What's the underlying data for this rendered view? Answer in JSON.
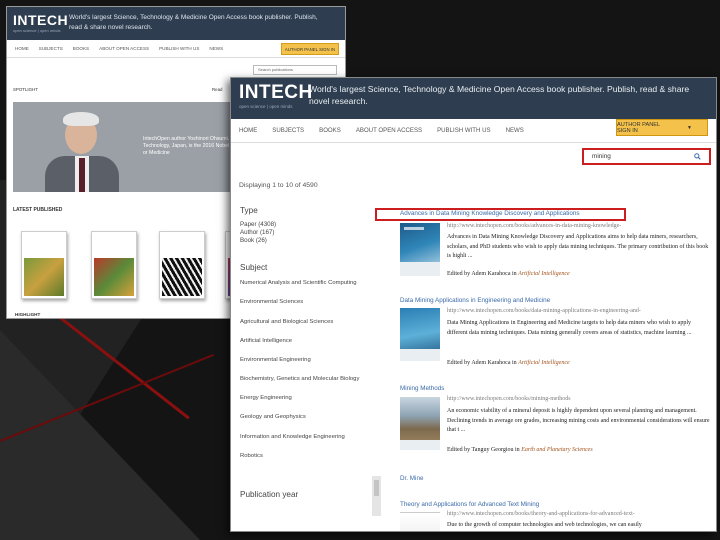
{
  "back_window": {
    "logo": "INTECH",
    "logo_sub": "open science | open minds",
    "tagline": "World's largest Science, Technology & Medicine Open Access book publisher. Publish, read & share novel research.",
    "nav": [
      "HOME",
      "SUBJECTS",
      "BOOKS",
      "ABOUT OPEN ACCESS",
      "PUBLISH WITH US",
      "NEWS"
    ],
    "author_button": "AUTHOR PANEL SIGN IN",
    "search_placeholder": "Search publications",
    "label_left": "SPOTLIGHT",
    "label_right": "Read",
    "banner_text": "IntechOpen author Yoshinori Ohsumi, Tokyo Institute of Technology, Japan, is the 2016 Nobel laureate in Physiology or Medicine",
    "latest": "LATEST PUBLISHED",
    "highlight": "HIGHLIGHT"
  },
  "front_window": {
    "logo": "INTECH",
    "logo_sub": "open science | open minds",
    "tagline": "World's largest Science, Technology & Medicine Open Access book publisher. Publish, read & share novel research.",
    "nav": [
      "HOME",
      "SUBJECTS",
      "BOOKS",
      "ABOUT OPEN ACCESS",
      "PUBLISH WITH US",
      "NEWS"
    ],
    "author_button": "AUTHOR PANEL SIGN IN",
    "search_value": "mining",
    "displaying": "Displaying 1 to 10 of 4590",
    "type_title": "Type",
    "types": [
      "Paper (4308)",
      "Author (167)",
      "Book (26)"
    ],
    "subject_title": "Subject",
    "subjects": [
      "Numerical Analysis and Scientific Computing",
      "Environmental Sciences",
      "Agricultural and Biological Sciences",
      "Artificial Intelligence",
      "Environmental Engineering",
      "Biochemistry, Genetics and Molecular Biology",
      "Energy Engineering",
      "Geology and Geophysics",
      "Information and Knowledge Engineering",
      "Robotics"
    ],
    "pubyear_title": "Publication year",
    "results": [
      {
        "title": "Advances in Data Mining Knowledge Discovery and Applications",
        "url": "http://www.intechopen.com/books/advances-in-data-mining-knowledge-",
        "desc": "Advances in Data Mining Knowledge Discovery and Applications aims to help data miners, researchers, scholars, and PhD students who wish to apply data mining techniques. The primary contribution of this book is highli ...",
        "edited_prefix": "Edited by Adem Karahoca in ",
        "edited_field": "Artificial Intelligence"
      },
      {
        "title": "Data Mining Applications in Engineering and Medicine",
        "url": "http://www.intechopen.com/books/data-mining-applications-in-engineering-and-",
        "desc": "Data Mining Applications in Engineering and Medicine targets to help data miners who wish to apply different data mining techniques. Data mining generally covers areas of statistics, machine learning ...",
        "edited_prefix": "Edited by Adem Karahoca in ",
        "edited_field": "Artificial Intelligence"
      },
      {
        "title": "Mining Methods",
        "url": "http://www.intechopen.com/books/mining-methods",
        "desc": "An economic viability of a mineral deposit is highly dependent upon several planning and management. Declining trends in average ore grades, increasing mining costs and environmental considerations will ensure that t ...",
        "edited_prefix": "Edited by Tanguy Georgiou in ",
        "edited_field": "Earth and Planetary Sciences"
      },
      {
        "title": "Dr. Mine",
        "url": "",
        "desc": "",
        "edited_prefix": "",
        "edited_field": ""
      },
      {
        "title": "Theory and Applications for Advanced Text Mining",
        "url": "http://www.intechopen.com/books/theory-and-applications-for-advanced-text-",
        "desc": "Due to the growth of computer technologies and web technologies, we can easily",
        "edited_prefix": "",
        "edited_field": ""
      }
    ]
  },
  "colors": {
    "header": "#2e3d4f",
    "accent_button": "#f4c24a",
    "link": "#3a6aa8",
    "highlight_box": "#cc1e1e"
  }
}
